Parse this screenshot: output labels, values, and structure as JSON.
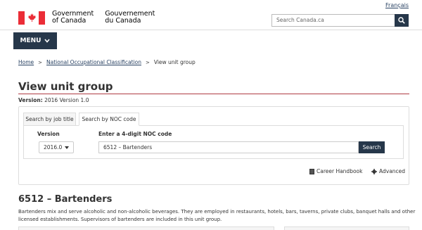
{
  "header": {
    "language_link": "Français",
    "wordmark_en_line1": "Government",
    "wordmark_en_line2": "of Canada",
    "wordmark_fr_line1": "Gouvernement",
    "wordmark_fr_line2": "du Canada",
    "search_placeholder": "Search Canada.ca",
    "flag_color": "#eb2d37"
  },
  "menu": {
    "label": "MENU"
  },
  "breadcrumb": {
    "items": [
      "Home",
      "National Occupational Classification",
      "View unit group"
    ]
  },
  "page": {
    "title": "View unit group",
    "version_label": "Version:",
    "version_value": "2016 Version 1.0"
  },
  "search_panel": {
    "tabs": [
      "Search by job title",
      "Search by NOC code"
    ],
    "active_tab": "Search by NOC code",
    "version_label": "Version",
    "version_selected": "2016.0",
    "noc_label": "Enter a 4-digit NOC code",
    "noc_value": "6512 – Bartenders",
    "search_button": "Search",
    "career_handbook": "Career Handbook",
    "advanced": "Advanced"
  },
  "unit_group": {
    "title": "6512 – Bartenders",
    "description": "Bartenders mix and serve alcoholic and non-alcoholic beverages. They are employed in restaurants, hotels, bars, taverns, private clubs, banquet halls and other licensed establishments. Supervisors of bartenders are included in this unit group."
  },
  "colors": {
    "primary_dark": "#26374a",
    "link": "#284162",
    "rule": "#af3c43"
  }
}
